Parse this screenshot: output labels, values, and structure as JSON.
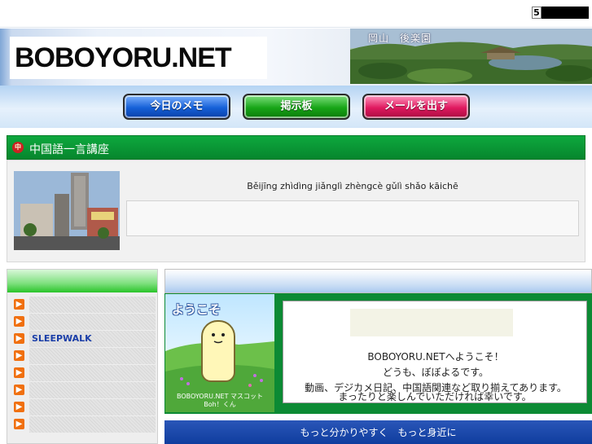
{
  "counter": {
    "first_digit": "5"
  },
  "header": {
    "logo": "BOBOYORU.NET",
    "photo_caption": "岡山　後楽園"
  },
  "nav": {
    "memo": "今日のメモ",
    "board": "掲示板",
    "mail": "メールを出す"
  },
  "chinese": {
    "title": "中国語一言講座",
    "icon_glyph": "中",
    "pinyin": "Běijīng zhìdìng jiǎnglì zhèngcè gǔlì shǎo kāichē"
  },
  "sidebar": {
    "items": [
      {
        "label": ""
      },
      {
        "label": ""
      },
      {
        "label": "SLEEPWALK"
      },
      {
        "label": ""
      },
      {
        "label": ""
      },
      {
        "label": ""
      },
      {
        "label": ""
      },
      {
        "label": ""
      }
    ]
  },
  "welcome": {
    "youkoso": "ようこそ",
    "mascot_caption_line1": "BOBOYORU.NET マスコット",
    "mascot_caption_line2": "Boh！くん",
    "line1": "BOBOYORU.NETへようこそ！",
    "line2": "どうも、ぼぼよるです。",
    "line3": "動画、デジカメ日記、中国語関連など取り揃えてあります。",
    "line4": "まったりと楽しんでいただければ幸いです。"
  },
  "slogan": "もっと分かりやすく　もっと身近に",
  "colors": {
    "green_accent": "#06862d",
    "blue_accent": "#0f3d9e",
    "sidebar_link": "#1a3ea8"
  },
  "icons": {
    "arrow": "arrow-right-icon",
    "chinese_badge": "china-badge-icon"
  }
}
